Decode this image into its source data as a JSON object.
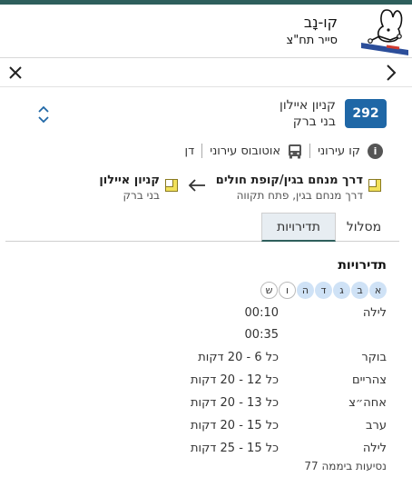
{
  "app": {
    "name": "קו-נָב",
    "subtitle": "סייר תח\"צ"
  },
  "line": {
    "number": "292",
    "destination": "קניון איילון",
    "destination_city": "בני ברק",
    "type": "קו עירוני",
    "vehicle": "אוטובוס עירוני",
    "operator": "דן"
  },
  "stops": {
    "from_name": "דרך מנחם בגין/קופת חולים",
    "from_sub": "דרך מנחם בגין, פתח תקווה",
    "to_name": "קניון איילון",
    "to_sub": "בני ברק"
  },
  "tabs": {
    "route": "מסלול",
    "frequencies": "תדירויות",
    "active": "frequencies"
  },
  "frequencies": {
    "title": "תדירויות",
    "days": [
      {
        "label": "א",
        "active": true
      },
      {
        "label": "ב",
        "active": true
      },
      {
        "label": "ג",
        "active": true
      },
      {
        "label": "ד",
        "active": true
      },
      {
        "label": "ה",
        "active": true
      },
      {
        "label": "ו",
        "active": false
      },
      {
        "label": "ש",
        "active": false
      }
    ],
    "rows": [
      {
        "period": "לילה",
        "value": "00:10"
      },
      {
        "period": "",
        "value": "00:35"
      },
      {
        "period": "בוקר",
        "value": "כל 6 - 20 דקות"
      },
      {
        "period": "צהריים",
        "value": "כל 12 - 20 דקות"
      },
      {
        "period": "אחה״צ",
        "value": "כל 13 - 20 דקות"
      },
      {
        "period": "ערב",
        "value": "כל 15 - 20 דקות"
      },
      {
        "period": "לילה",
        "value": "כל 15 - 25 דקות"
      }
    ],
    "trips_per_day": "77 נסיעות ביממה"
  },
  "colors": {
    "accent": "#2e5f5c",
    "badge": "#1f67a6",
    "stop_marker": "#f2e15a"
  }
}
